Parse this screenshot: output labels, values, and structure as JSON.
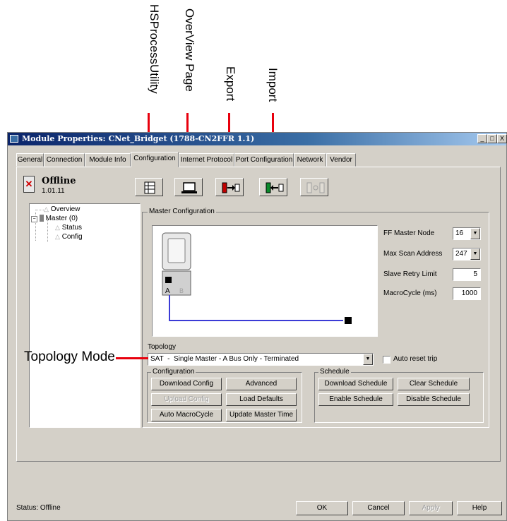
{
  "callouts": {
    "hsprocess": "HSProcessUtility",
    "overview": "OverView Page",
    "export": "Export",
    "import": "Import",
    "topology_mode": "Topology Mode"
  },
  "window": {
    "title": "Module Properties: CNet_Bridget (1788-CN2FFR 1.1)",
    "controls": [
      "_",
      "□",
      "X"
    ]
  },
  "tabs": [
    {
      "label": "General"
    },
    {
      "label": "Connection"
    },
    {
      "label": "Module Info"
    },
    {
      "label": "Configuration",
      "active": true
    },
    {
      "label": "Internet Protocol"
    },
    {
      "label": "Port Configuration"
    },
    {
      "label": "Network"
    },
    {
      "label": "Vendor"
    }
  ],
  "module_state": {
    "title": "Offline",
    "version": "1.01.11"
  },
  "toolbar": {
    "icons": [
      "hsprocessutility-icon",
      "overview-page-icon",
      "export-icon",
      "import-icon",
      "disabled-transfer-icon"
    ]
  },
  "tree": {
    "items": [
      {
        "label": "Overview"
      },
      {
        "label": "Master (0)"
      },
      {
        "label": "Status"
      },
      {
        "label": "Config"
      }
    ]
  },
  "master_config": {
    "group_label": "Master Configuration",
    "fields": [
      {
        "label": "FF Master Node",
        "value": "16"
      },
      {
        "label": "Max Scan Address",
        "value": "247"
      },
      {
        "label": "Slave Retry Limit",
        "value": "5"
      },
      {
        "label": "MacroCycle (ms)",
        "value": "1000"
      }
    ],
    "port_labels": {
      "a": "A",
      "b": "B",
      "t": "T"
    }
  },
  "topology": {
    "label": "Topology",
    "selected": "SAT  -  Single Master - A Bus Only - Terminated",
    "auto_reset_label": "Auto reset trip",
    "auto_reset_checked": false
  },
  "configuration_group": {
    "label": "Configuration",
    "buttons": [
      {
        "label": "Download Config",
        "enabled": true
      },
      {
        "label": "Advanced",
        "enabled": true
      },
      {
        "label": "Upload Config",
        "enabled": false
      },
      {
        "label": "Load Defaults",
        "enabled": true
      },
      {
        "label": "Auto MacroCycle",
        "enabled": true
      },
      {
        "label": "Update Master Time",
        "enabled": true
      }
    ]
  },
  "schedule_group": {
    "label": "Schedule",
    "buttons": [
      {
        "label": "Download Schedule",
        "enabled": true
      },
      {
        "label": "Clear Schedule",
        "enabled": true
      },
      {
        "label": "Enable Schedule",
        "enabled": true
      },
      {
        "label": "Disable Schedule",
        "enabled": true
      }
    ]
  },
  "footer": {
    "status": "Status:  Offline",
    "ok": "OK",
    "cancel": "Cancel",
    "apply": "Apply",
    "help": "Help"
  },
  "colors": {
    "annotation_red": "#e8000d",
    "diagram_bus": "#3b3bd6",
    "titlebar": "#0a246a"
  }
}
